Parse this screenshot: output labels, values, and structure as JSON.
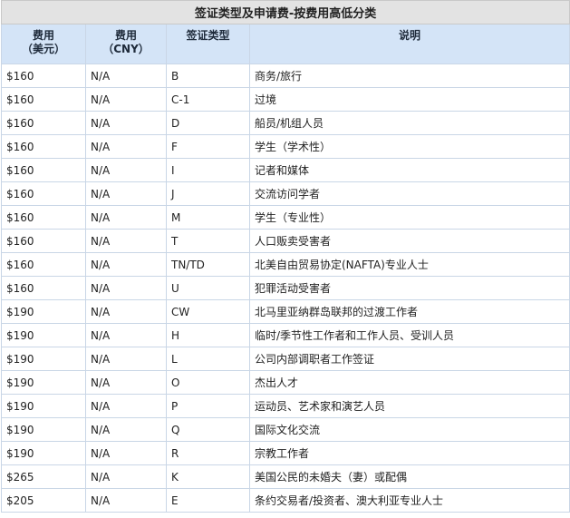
{
  "table": {
    "title": "签证类型及申请费-按费用高低分类",
    "headers": {
      "fee_usd_line1": "费用",
      "fee_usd_line2": "（美元）",
      "fee_cny_line1": "费用",
      "fee_cny_line2": "（CNY）",
      "visa_type": "签证类型",
      "description": "说明"
    },
    "rows": [
      {
        "usd": "$160",
        "cny": "N/A",
        "type": "B",
        "desc": "商务/旅行"
      },
      {
        "usd": "$160",
        "cny": "N/A",
        "type": "C-1",
        "desc": "过境"
      },
      {
        "usd": "$160",
        "cny": "N/A",
        "type": "D",
        "desc": "船员/机组人员"
      },
      {
        "usd": "$160",
        "cny": "N/A",
        "type": "F",
        "desc": "学生（学术性）"
      },
      {
        "usd": "$160",
        "cny": "N/A",
        "type": "I",
        "desc": "记者和媒体"
      },
      {
        "usd": "$160",
        "cny": "N/A",
        "type": "J",
        "desc": "交流访问学者"
      },
      {
        "usd": "$160",
        "cny": "N/A",
        "type": "M",
        "desc": "学生（专业性）"
      },
      {
        "usd": "$160",
        "cny": "N/A",
        "type": "T",
        "desc": "人口贩卖受害者"
      },
      {
        "usd": "$160",
        "cny": "N/A",
        "type": "TN/TD",
        "desc": "北美自由贸易协定(NAFTA)专业人士"
      },
      {
        "usd": "$160",
        "cny": "N/A",
        "type": "U",
        "desc": "犯罪活动受害者"
      },
      {
        "usd": "$190",
        "cny": "N/A",
        "type": "CW",
        "desc": "北马里亚纳群岛联邦的过渡工作者"
      },
      {
        "usd": "$190",
        "cny": "N/A",
        "type": "H",
        "desc": "临时/季节性工作者和工作人员、受训人员"
      },
      {
        "usd": "$190",
        "cny": "N/A",
        "type": "L",
        "desc": "公司内部调职者工作签证"
      },
      {
        "usd": "$190",
        "cny": "N/A",
        "type": "O",
        "desc": "杰出人才"
      },
      {
        "usd": "$190",
        "cny": "N/A",
        "type": "P",
        "desc": "运动员、艺术家和演艺人员"
      },
      {
        "usd": "$190",
        "cny": "N/A",
        "type": "Q",
        "desc": "国际文化交流"
      },
      {
        "usd": "$190",
        "cny": "N/A",
        "type": "R",
        "desc": "宗教工作者"
      },
      {
        "usd": "$265",
        "cny": "N/A",
        "type": "K",
        "desc": "美国公民的未婚夫（妻）或配偶"
      },
      {
        "usd": "$205",
        "cny": "N/A",
        "type": "E",
        "desc": "条约交易者/投资者、澳大利亚专业人士"
      }
    ]
  }
}
